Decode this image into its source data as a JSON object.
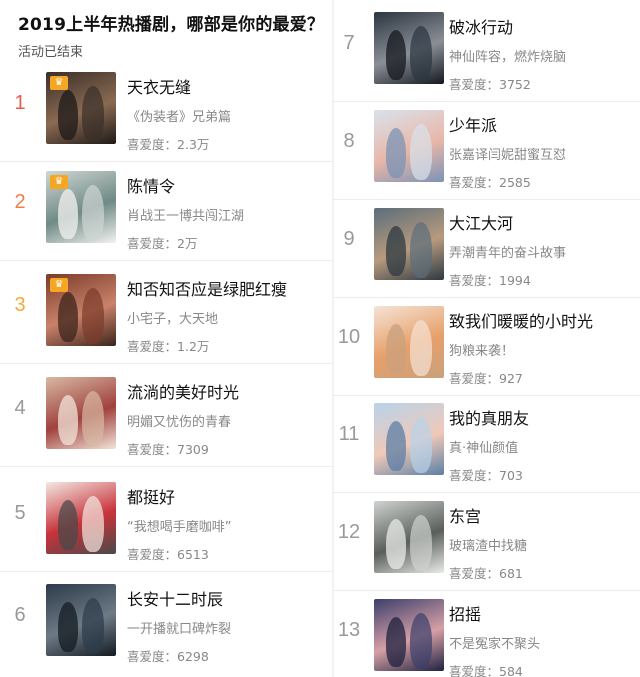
{
  "header": {
    "title": "2019上半年热播剧，哪部是你的最爱？",
    "status": "活动已结束"
  },
  "popularity_label": "喜爱度：",
  "left_items": [
    {
      "rank": "1",
      "name": "天衣无缝",
      "desc": "《伪装者》兄弟篇",
      "popularity": "2.3万",
      "crown": true,
      "poster_colors": [
        "#3a2f2a",
        "#8a6a52",
        "#1e1a18"
      ]
    },
    {
      "rank": "2",
      "name": "陈情令",
      "desc": "肖战王一博共闯江湖",
      "popularity": "2万",
      "crown": true,
      "poster_colors": [
        "#cfd6d3",
        "#6f8a86",
        "#f2f2ef"
      ]
    },
    {
      "rank": "3",
      "name": "知否知否应是绿肥红瘦",
      "desc": "小宅子，大天地",
      "popularity": "1.2万",
      "crown": true,
      "poster_colors": [
        "#7a3b2a",
        "#c9826a",
        "#3d241c"
      ]
    },
    {
      "rank": "4",
      "name": "流淌的美好时光",
      "desc": "明媚又忧伤的青春",
      "popularity": "7309",
      "crown": false,
      "poster_colors": [
        "#d8b9a4",
        "#a0413c",
        "#f1e4da"
      ]
    },
    {
      "rank": "5",
      "name": "都挺好",
      "desc": "“我想喝手磨咖啡”",
      "popularity": "6513",
      "crown": false,
      "poster_colors": [
        "#f3e9e3",
        "#c8323a",
        "#4a4a4a"
      ]
    },
    {
      "rank": "6",
      "name": "长安十二时辰",
      "desc": "一开播就口碑炸裂",
      "popularity": "6298",
      "crown": false,
      "poster_colors": [
        "#2c3a4a",
        "#6d7b86",
        "#141b22"
      ]
    }
  ],
  "right_items": [
    {
      "rank": "7",
      "name": "破冰行动",
      "desc": "神仙阵容，燃炸烧脑",
      "popularity": "3752",
      "poster_colors": [
        "#2b3440",
        "#8a8f96",
        "#15191f"
      ]
    },
    {
      "rank": "8",
      "name": "少年派",
      "desc": "张嘉译闫妮甜蜜互怼",
      "popularity": "2585",
      "poster_colors": [
        "#d9e2ec",
        "#e9b7a8",
        "#7b93b6"
      ]
    },
    {
      "rank": "9",
      "name": "大江大河",
      "desc": "弄潮青年的奋斗故事",
      "popularity": "1994",
      "poster_colors": [
        "#5b6e7a",
        "#b89a7e",
        "#2d3942"
      ]
    },
    {
      "rank": "10",
      "name": "致我们暖暖的小时光",
      "desc": "狗粮来袭！",
      "popularity": "927",
      "poster_colors": [
        "#f5e3d6",
        "#e7a06a",
        "#c9a07d"
      ]
    },
    {
      "rank": "11",
      "name": "我的真朋友",
      "desc": "真·神仙颜值",
      "popularity": "703",
      "poster_colors": [
        "#b7d3ea",
        "#f0c9b8",
        "#5c7fa6"
      ]
    },
    {
      "rank": "12",
      "name": "东宫",
      "desc": "玻璃渣中找糖",
      "popularity": "681",
      "poster_colors": [
        "#cfd2cf",
        "#5a5f5c",
        "#e9ebe8"
      ]
    },
    {
      "rank": "13",
      "name": "招摇",
      "desc": "不是冤家不聚头",
      "popularity": "584",
      "poster_colors": [
        "#3b3f6b",
        "#d6a0a6",
        "#1f2140"
      ]
    }
  ]
}
